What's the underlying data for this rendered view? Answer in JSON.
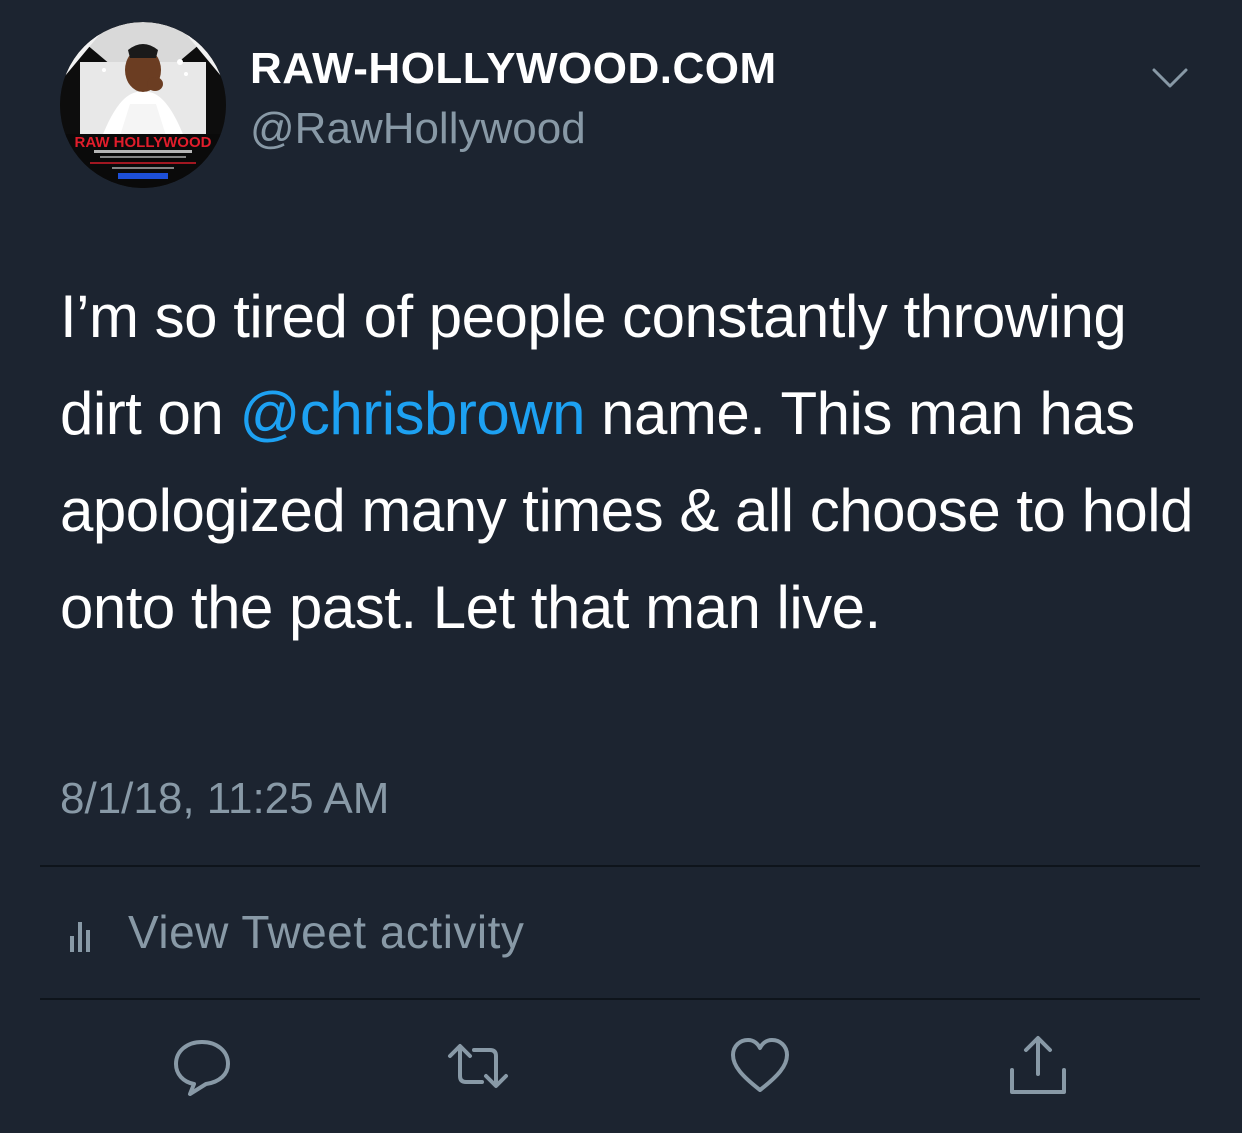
{
  "author": {
    "display_name": "RAW-HOLLYWOOD.COM",
    "handle": "@RawHollywood",
    "avatar_logo_text": "RAW HOLLYWOOD"
  },
  "tweet": {
    "text_before_mention": "I’m so tired of people constantly throwing dirt on ",
    "mention": "@chrisbrown",
    "text_after_mention": " name. This man has apologized many times & all choose to hold onto the past. Let that man live.",
    "timestamp": "8/1/18, 11:25 AM"
  },
  "activity": {
    "label": "View Tweet activity",
    "icon": "bar-chart-icon"
  },
  "actions": [
    {
      "name": "reply",
      "icon": "speech-bubble-icon"
    },
    {
      "name": "retweet",
      "icon": "retweet-arrows-icon"
    },
    {
      "name": "like",
      "icon": "heart-icon"
    },
    {
      "name": "share",
      "icon": "share-upload-icon"
    }
  ],
  "colors": {
    "background": "#1c2430",
    "text_primary": "#ffffff",
    "text_secondary": "#8899a6",
    "link": "#1da1f2",
    "divider": "#0e141b"
  }
}
